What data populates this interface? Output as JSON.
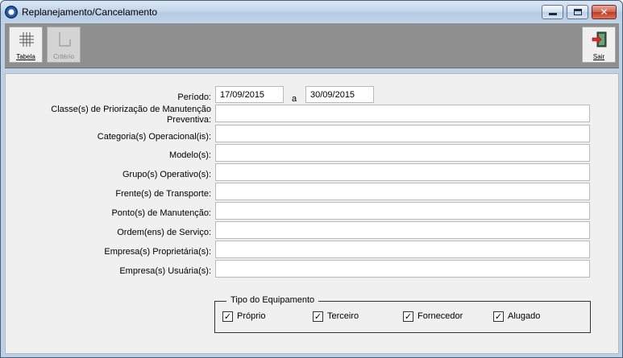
{
  "window": {
    "title": "Replanejamento/Cancelamento",
    "controls": {
      "minimize": "–",
      "maximize": "□",
      "close": "✕"
    }
  },
  "toolbar": {
    "tabela_label": "Tabela",
    "criterio_label": "Critério",
    "sair_label": "Sair",
    "icons": {
      "tabela": "grid-icon",
      "criterio": "bracket-icon",
      "sair": "exit-door-icon"
    }
  },
  "form": {
    "periodo": {
      "label": "Período:",
      "start": "17/09/2015",
      "separator": "a",
      "end": "30/09/2015"
    },
    "fields": [
      {
        "label": "Classe(s) de Priorização de Manutenção Preventiva:",
        "value": ""
      },
      {
        "label": "Categoria(s) Operacional(is):",
        "value": ""
      },
      {
        "label": "Modelo(s):",
        "value": ""
      },
      {
        "label": "Grupo(s) Operativo(s):",
        "value": ""
      },
      {
        "label": "Frente(s) de Transporte:",
        "value": ""
      },
      {
        "label": "Ponto(s) de Manutenção:",
        "value": ""
      },
      {
        "label": "Ordem(ens) de Serviço:",
        "value": ""
      },
      {
        "label": "Empresa(s) Proprietária(s):",
        "value": ""
      },
      {
        "label": "Empresa(s) Usuária(s):",
        "value": ""
      }
    ],
    "tipo_equipamento": {
      "legend": "Tipo do Equipamento",
      "options": [
        {
          "label": "Próprio",
          "checked": true
        },
        {
          "label": "Terceiro",
          "checked": true
        },
        {
          "label": "Fornecedor",
          "checked": true
        },
        {
          "label": "Alugado",
          "checked": true
        }
      ]
    }
  },
  "colors": {
    "titlebar": "#c4d6ea",
    "toolbar": "#8f8f8f",
    "panel": "#f0f0f0",
    "close_button": "#c0391f"
  }
}
